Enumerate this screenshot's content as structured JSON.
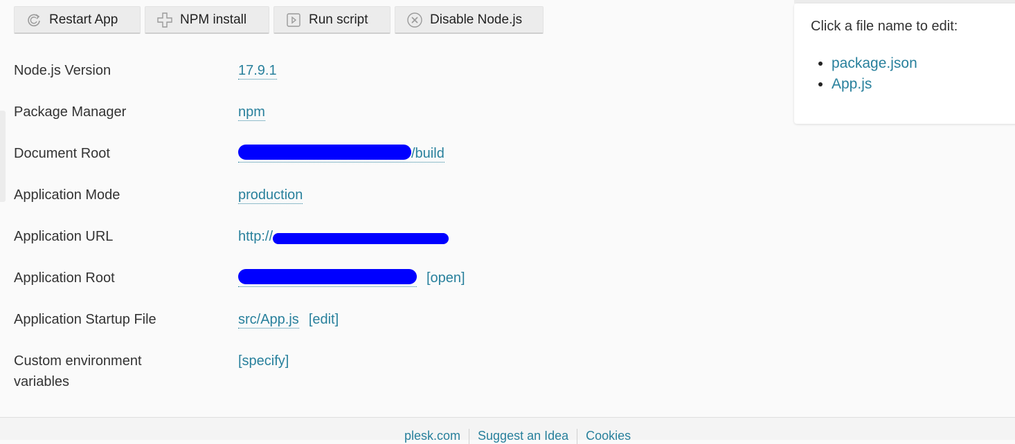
{
  "toolbar": {
    "buttons": [
      {
        "label": "Restart App",
        "icon": "restart-icon"
      },
      {
        "label": "NPM install",
        "icon": "plus-icon"
      },
      {
        "label": "Run script",
        "icon": "play-icon"
      },
      {
        "label": "Disable Node.js",
        "icon": "close-circle-icon"
      }
    ]
  },
  "properties": [
    {
      "label": "Node.js Version",
      "value": "17.9.1"
    },
    {
      "label": "Package Manager",
      "value": "npm"
    },
    {
      "label": "Document Root",
      "value": "/build",
      "redacted": true
    },
    {
      "label": "Application Mode",
      "value": "production"
    },
    {
      "label": "Application URL",
      "value": "http://",
      "redacted": true
    },
    {
      "label": "Application Root",
      "value": "",
      "redacted": true,
      "action": "[open]"
    },
    {
      "label": "Application Startup File",
      "value": "src/App.js",
      "action": "[edit]"
    },
    {
      "label": "Custom environment variables",
      "action": "[specify]"
    }
  ],
  "side_panel": {
    "hint": "Click a file name to edit:",
    "files": [
      "package.json",
      "App.js"
    ]
  },
  "footer": {
    "links": [
      "plesk.com",
      "Suggest an Idea",
      "Cookies"
    ]
  },
  "colors": {
    "link": "#28809c",
    "redaction": "#0000ff"
  }
}
